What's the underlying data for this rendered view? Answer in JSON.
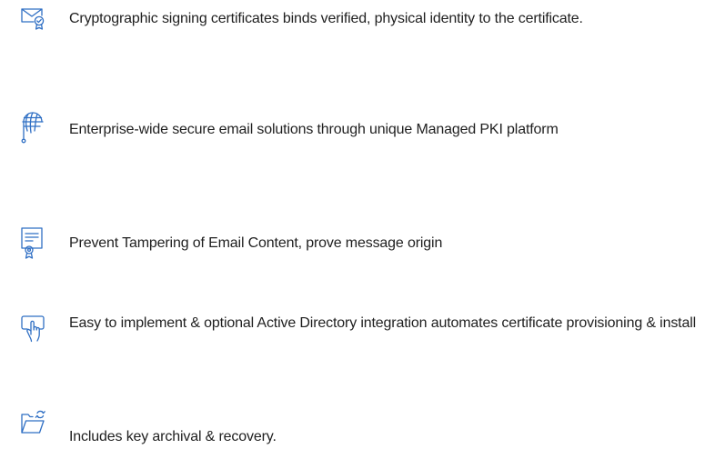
{
  "accent_color": "#2f6fc4",
  "features": [
    {
      "icon": "envelope-certificate-icon",
      "text": "Cryptographic signing certificates binds verified, physical identity to the  certificate."
    },
    {
      "icon": "globe-network-icon",
      "text": "Enterprise-wide secure email solutions through unique Managed PKI  platform"
    },
    {
      "icon": "document-seal-icon",
      "text": "Prevent Tampering of Email Content, prove message origin"
    },
    {
      "icon": "touch-screen-hand-icon",
      "text": "Easy to implement & optional Active Directory integration automates  certificate provisioning & install"
    },
    {
      "icon": "folder-sync-icon",
      "text": "Includes key archival & recovery."
    }
  ]
}
